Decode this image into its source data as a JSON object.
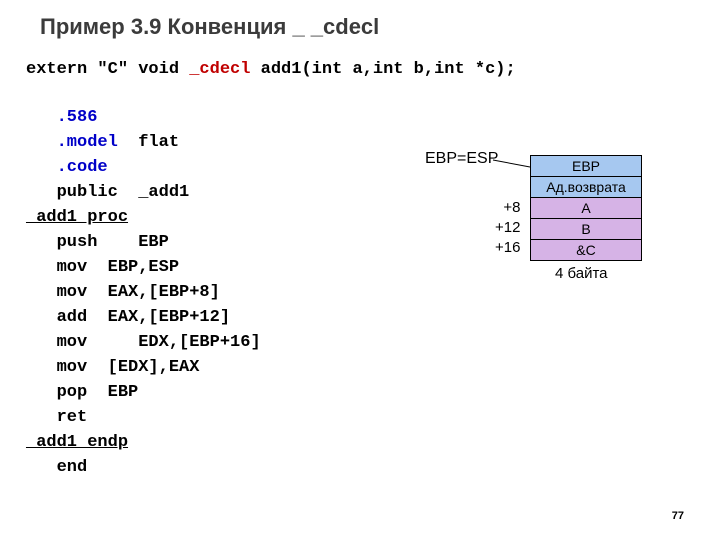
{
  "title": "Пример 3.9 Конвенция _ _cdecl",
  "decl": {
    "p1": "extern \"C\" void ",
    "hl": "_cdecl",
    "p2": " add1(int a,int b,int *c);"
  },
  "code": {
    "d586": ".586",
    "model": ".model",
    "model_arg": "  flat",
    "dcode": ".code",
    "pub": "public  _add1",
    "proc": "_add1 proc",
    "l1": "push    EBP",
    "l2": "mov  EBP,ESP",
    "l3": "mov  EAX,[EBP+8]",
    "l4": "add  EAX,[EBP+12]",
    "l5": "mov     EDX,[EBP+16]",
    "l6": "mov  [EDX],EAX",
    "l7": "pop  EBP",
    "l8": "ret",
    "endp": "_add1 endp",
    "end": "end"
  },
  "diagram": {
    "ebp_esp": "EBP=ESP",
    "off8": "+8",
    "off12": "+12",
    "off16": "+16",
    "cells": {
      "ebp": "EBP",
      "ret": "Ад.возврата",
      "a": "A",
      "b": "B",
      "c": "&C"
    },
    "bytes": "4 байта"
  },
  "pagenum": "77"
}
